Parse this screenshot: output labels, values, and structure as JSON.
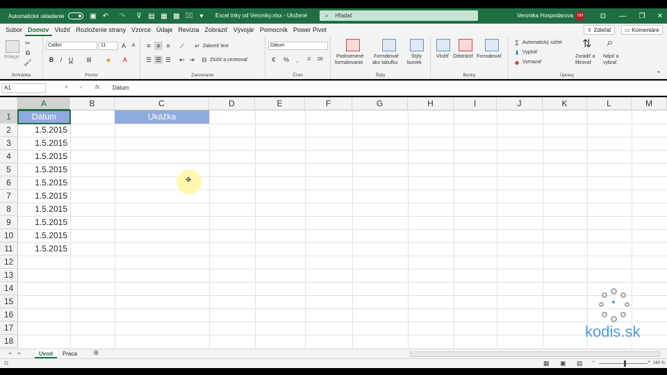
{
  "titlebar": {
    "autosave_label": "Automatické ukladanie",
    "file_title": "Excel triky od Veroniky.xlsx  -  Uložené",
    "search_placeholder": "Hľadať",
    "user_name": "Veronika Hospodarova",
    "user_initials": "VH"
  },
  "menu": {
    "tabs": [
      "Súbor",
      "Domov",
      "Vložiť",
      "Rozloženie strany",
      "Vzorce",
      "Údaje",
      "Revízia",
      "Zobraziť",
      "Vývojár",
      "Pomocník",
      "Power Pivot"
    ],
    "active": "Domov",
    "share_label": "Zdieľať",
    "comments_label": "Komentáre"
  },
  "ribbon": {
    "clipboard": {
      "label": "Schránka",
      "paste": "Prilepiť"
    },
    "font": {
      "label": "Písmo",
      "name": "Calibri",
      "size": "11",
      "bold": "B",
      "italic": "I",
      "underline": "U"
    },
    "alignment": {
      "label": "Zarovnanie",
      "wrap": "Zalomiť text",
      "merge": "Zlúčiť a centrovať"
    },
    "number": {
      "label": "Číslo",
      "format": "Dátum"
    },
    "styles": {
      "label": "Štýly",
      "conditional_1": "Podmienené",
      "conditional_2": "formátovanie",
      "table_1": "Formátovať",
      "table_2": "ako tabuľku",
      "cell_styles_1": "Štýly",
      "cell_styles_2": "buniek"
    },
    "cells": {
      "label": "Bunky",
      "insert": "Vložiť",
      "delete": "Odstrániť",
      "format": "Formátovať"
    },
    "editing": {
      "label": "Úpravy",
      "autosum": "Automatický súčet",
      "fill": "Vyplniť",
      "clear": "Vymazať",
      "sort_1": "Zoradiť a",
      "sort_2": "filtrovať",
      "find_1": "Nájsť a",
      "find_2": "vybrať"
    }
  },
  "formula_bar": {
    "name_box": "A1",
    "fx": "fx",
    "content": "Dátum"
  },
  "grid": {
    "columns": [
      "A",
      "B",
      "C",
      "D",
      "E",
      "F",
      "G",
      "H",
      "I",
      "J",
      "K",
      "L",
      "M"
    ],
    "rows": [
      "1",
      "2",
      "3",
      "4",
      "5",
      "6",
      "7",
      "8",
      "9",
      "10",
      "11",
      "12",
      "13",
      "14",
      "15",
      "16",
      "17",
      "18"
    ],
    "a1": "Dátum",
    "c1": "Ukážka",
    "dates": [
      "1.5.2015",
      "1.5.2015",
      "1.5.2015",
      "1.5.2015",
      "1.5.2015",
      "1.5.2015",
      "1.5.2015",
      "1.5.2015",
      "1.5.2015",
      "1.5.2015"
    ],
    "header_color": "#8faadc"
  },
  "logo": {
    "text": "kodis.sk",
    "color": "#4d9bd6"
  },
  "sheets": {
    "tabs": [
      "Uvod",
      "Praca"
    ],
    "active": "Uvod"
  },
  "status": {
    "zoom": "160 %"
  }
}
